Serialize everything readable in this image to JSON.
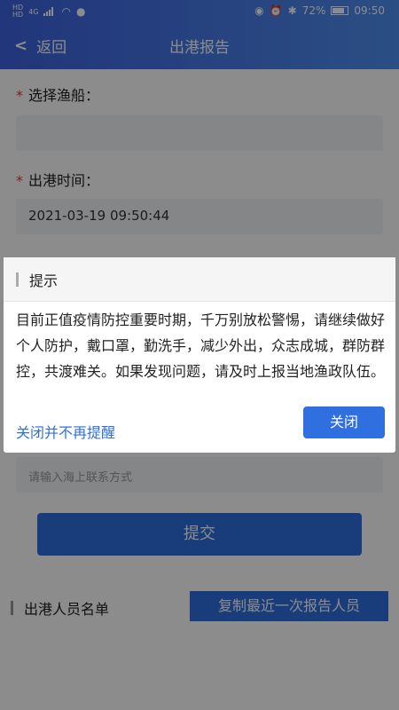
{
  "status_bar": {
    "left_labels": [
      "HD",
      "4G",
      "HD"
    ],
    "battery": "72%",
    "time": "09:50",
    "icons": [
      "hd-icon",
      "signal-icon",
      "wifi-icon",
      "message-icon",
      "eye-icon",
      "alarm-icon",
      "bluetooth-icon",
      "battery-icon"
    ]
  },
  "nav": {
    "back_label": "返回",
    "title": "出港报告"
  },
  "form": {
    "boat_label": "选择渔船：",
    "boat_value": "",
    "time_label": "出港时间：",
    "time_value": "2021-03-19 09:50:44",
    "contact_placeholder": "请输入海上联系方式",
    "submit_label": "提交"
  },
  "personnel": {
    "section_title": "出港人员名单",
    "copy_button": "复制最近一次报告人员"
  },
  "dialog": {
    "title": "提示",
    "message": "目前正值疫情防控重要时期，千万别放松警惕，请继续做好个人防护，戴口罩，勤洗手，减少外出，众志成城，群防群控，共渡难关。如果发现问题，请及时上报当地渔政队伍。",
    "never_again_label": "关闭并不再提醒",
    "close_label": "关闭"
  },
  "colors": {
    "header_gradient_start": "#3d63e0",
    "header_gradient_end": "#4f8ef0",
    "primary": "#2f6fe0",
    "required": "#e53935"
  }
}
